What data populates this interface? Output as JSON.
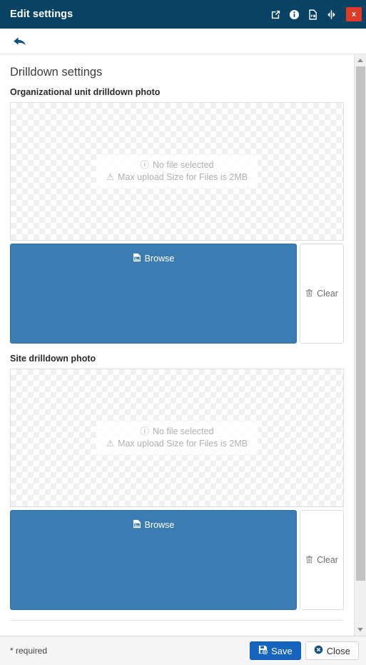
{
  "titlebar": {
    "title": "Edit settings",
    "icons": [
      {
        "name": "popout-icon"
      },
      {
        "name": "info-icon"
      },
      {
        "name": "pdf-icon"
      },
      {
        "name": "resize-width-icon"
      }
    ],
    "close_label": "x"
  },
  "toolbar": {
    "back_label": "back-arrow"
  },
  "main": {
    "section_title": "Drilldown settings",
    "groups": [
      {
        "label": "Organizational unit drilldown photo",
        "no_file_text": "No file selected",
        "max_upload_text": "Max upload Size for Files is 2MB",
        "browse_label": "Browse",
        "clear_label": "Clear"
      },
      {
        "label": "Site drilldown photo",
        "no_file_text": "No file selected",
        "max_upload_text": "Max upload Size for Files is 2MB",
        "browse_label": "Browse",
        "clear_label": "Clear"
      }
    ]
  },
  "footer": {
    "required_note": "* required",
    "save_label": "Save",
    "close_label": "Close"
  },
  "colors": {
    "titlebar_bg": "#0a4265",
    "close_red": "#e03b26",
    "browse_blue": "#3b7cb3",
    "save_blue": "#1565c0",
    "footer_bg": "#f5f5f5"
  }
}
